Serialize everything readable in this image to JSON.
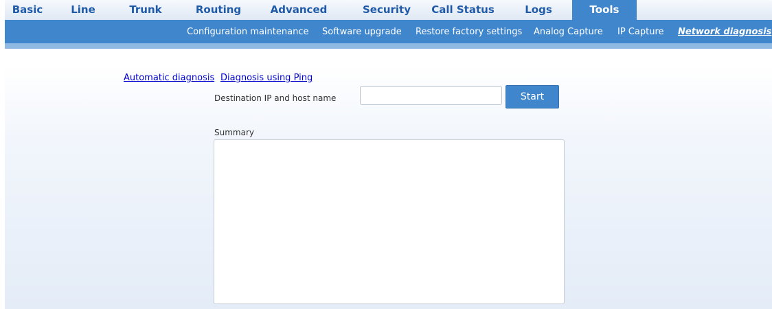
{
  "top_nav": {
    "tabs": [
      {
        "label": "Basic"
      },
      {
        "label": "Line"
      },
      {
        "label": "Trunk"
      },
      {
        "label": "Routing"
      },
      {
        "label": "Advanced"
      },
      {
        "label": "Security"
      },
      {
        "label": "Call Status"
      },
      {
        "label": "Logs"
      },
      {
        "label": "Tools",
        "active": true
      }
    ]
  },
  "sub_nav": {
    "items": [
      {
        "label": "Configuration maintenance"
      },
      {
        "label": "Software upgrade"
      },
      {
        "label": "Restore factory settings"
      },
      {
        "label": "Analog Capture"
      },
      {
        "label": "IP Capture"
      },
      {
        "label": "Network diagnosis",
        "active": true
      }
    ]
  },
  "diagnosis": {
    "links": {
      "automatic": "Automatic diagnosis",
      "ping": "Diagnosis using Ping"
    },
    "destination_label": "Destination IP and host name",
    "destination_value": "",
    "start_label": "Start",
    "summary_label": "Summary",
    "summary_value": ""
  },
  "colors": {
    "nav_text": "#1f5aa8",
    "accent": "#3f86cc",
    "link": "#0000cc"
  }
}
